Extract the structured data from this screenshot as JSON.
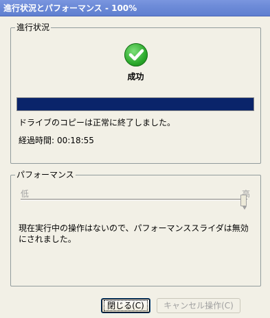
{
  "window": {
    "title": "進行状況とパフォーマンス - 100%"
  },
  "progress_group": {
    "title": "進行状況",
    "status": "成功",
    "progress_percent": 100,
    "message": "ドライブのコピーは正常に終了しました。",
    "elapsed_label": "経過時間:",
    "elapsed_value": "00:18:55"
  },
  "performance_group": {
    "title": "パフォーマンス",
    "slider_low": "低",
    "slider_high": "高",
    "slider_level_percent": 100,
    "message": "現在実行中の操作はないので、パフォーマンススライダは無効にされました。"
  },
  "buttons": {
    "close": "閉じる(C)",
    "cancel": "キャンセル操作(C)"
  },
  "icons": {
    "status_icon": "success-check-icon"
  },
  "colors": {
    "progress_fill": "#0a246a",
    "success": "#2aa82a"
  }
}
